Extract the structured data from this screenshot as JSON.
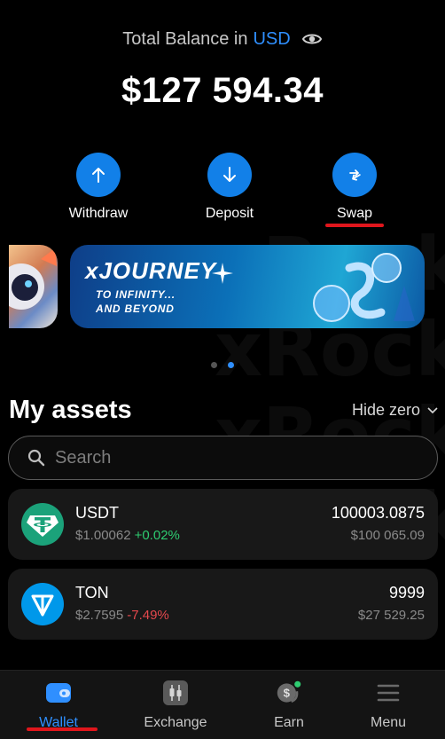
{
  "header": {
    "balance_label": "Total Balance in",
    "currency": "USD",
    "balance": "$127 594.34"
  },
  "actions": [
    {
      "label": "Withdraw",
      "icon": "arrow-up-icon"
    },
    {
      "label": "Deposit",
      "icon": "arrow-down-icon"
    },
    {
      "label": "Swap",
      "icon": "swap-arrows-icon"
    }
  ],
  "banner": {
    "title": "xJOURNEY",
    "subtitle_line1": "TO INFINITY...",
    "subtitle_line2": "AND BEYOND",
    "watermark": "xRocket"
  },
  "carousel": {
    "page_count": 2,
    "active_page": 2
  },
  "assets": {
    "title": "My assets",
    "hide_zero_label": "Hide zero",
    "search_placeholder": "Search",
    "items": [
      {
        "symbol": "USDT",
        "price": "$1.00062",
        "change": "+0.02%",
        "amount": "100003.0875",
        "fiat_value": "$100 065.09",
        "change_color": "#2ecc71",
        "logo_color": "#1ba27a"
      },
      {
        "symbol": "TON",
        "price": "$2.7595",
        "change": "-7.49%",
        "amount": "9999",
        "fiat_value": "$27 529.25",
        "change_color": "#e5484d",
        "logo_color": "#0098ea"
      }
    ]
  },
  "nav": {
    "items": [
      {
        "label": "Wallet",
        "icon": "wallet-icon",
        "active": true
      },
      {
        "label": "Exchange",
        "icon": "candlestick-icon",
        "active": false
      },
      {
        "label": "Earn",
        "icon": "dollar-coins-icon",
        "active": false
      },
      {
        "label": "Menu",
        "icon": "hamburger-menu-icon",
        "active": false
      }
    ]
  },
  "colors": {
    "accent": "#1280e8",
    "highlight_underline": "#e0161c"
  }
}
